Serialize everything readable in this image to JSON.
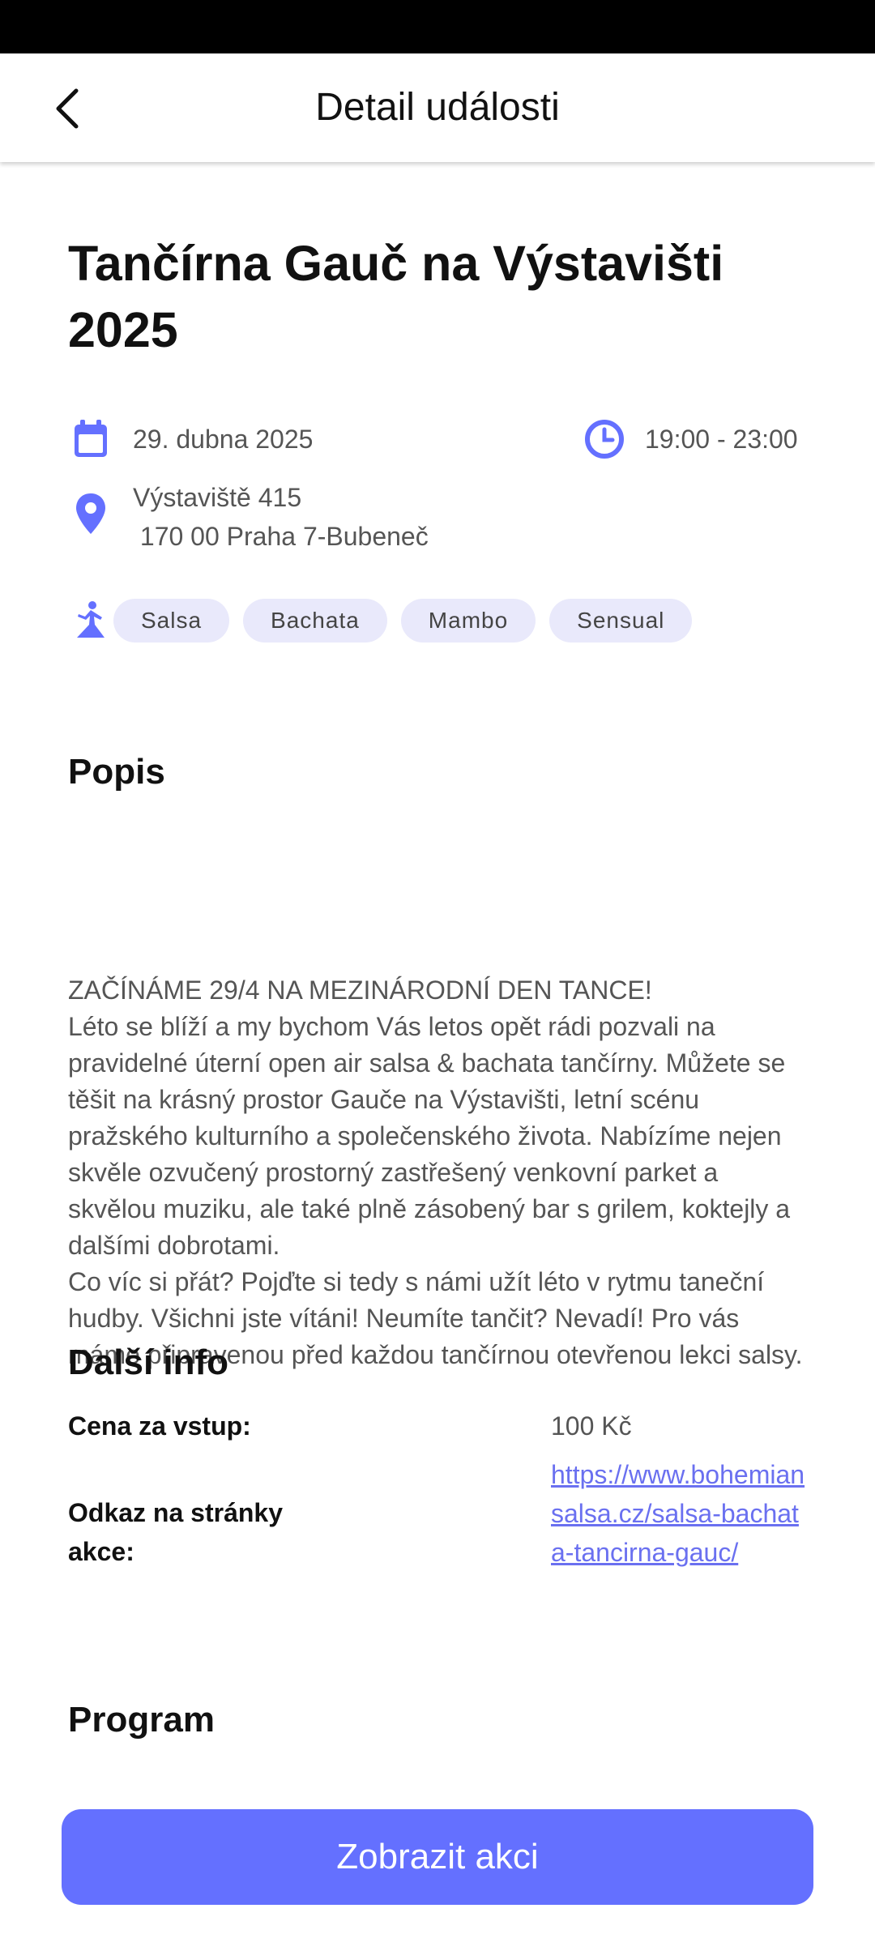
{
  "app_bar": {
    "title": "Detail události"
  },
  "event": {
    "title": "Tančírna Gauč na Výstavišti 2025",
    "date": "29. dubna 2025",
    "time": "19:00 - 23:00",
    "address": "Výstaviště 415\n 170 00 Praha 7-Bubeneč",
    "tags": [
      "Salsa",
      "Bachata",
      "Mambo",
      "Sensual"
    ]
  },
  "description": {
    "heading": "Popis",
    "text": "ZAČÍNÁME 29/4 NA MEZINÁRODNÍ DEN TANCE!\nLéto se blíží a my bychom Vás letos opět rádi pozvali na pravidelné úterní open air salsa & bachata tančírny. Můžete se těšit na krásný prostor Gauče na Výstavišti, letní scénu pražského kulturního a společenského života. Nabízíme nejen skvěle ozvučený prostorný zastřešený venkovní parket a skvělou muziku, ale také plně zásobený bar s grilem, koktejly a dalšími dobrotami.\nCo víc si přát? Pojďte si tedy s námi užít léto v rytmu taneční hudby. Všichni jste vítáni! Neumíte tančit? Nevadí! Pro vás máme připravenou před každou tančírnou otevřenou lekci salsy."
  },
  "more_info": {
    "heading": "Další info",
    "price_label": "Cena za vstup:",
    "price_value": "100 Kč",
    "link_label": "Odkaz na stránky akce:",
    "link_value": "https://www.bohemiansalsa.cz/salsa-bachata-tancirna-gauc/"
  },
  "program": {
    "heading": "Program"
  },
  "cta": {
    "label": "Zobrazit akci"
  },
  "colors": {
    "accent": "#6470ff",
    "tag_bg": "#e9e9fb",
    "link": "#6a70f0"
  },
  "icons": [
    "back-arrow-icon",
    "calendar-icon",
    "clock-icon",
    "location-pin-icon",
    "dancer-icon"
  ]
}
